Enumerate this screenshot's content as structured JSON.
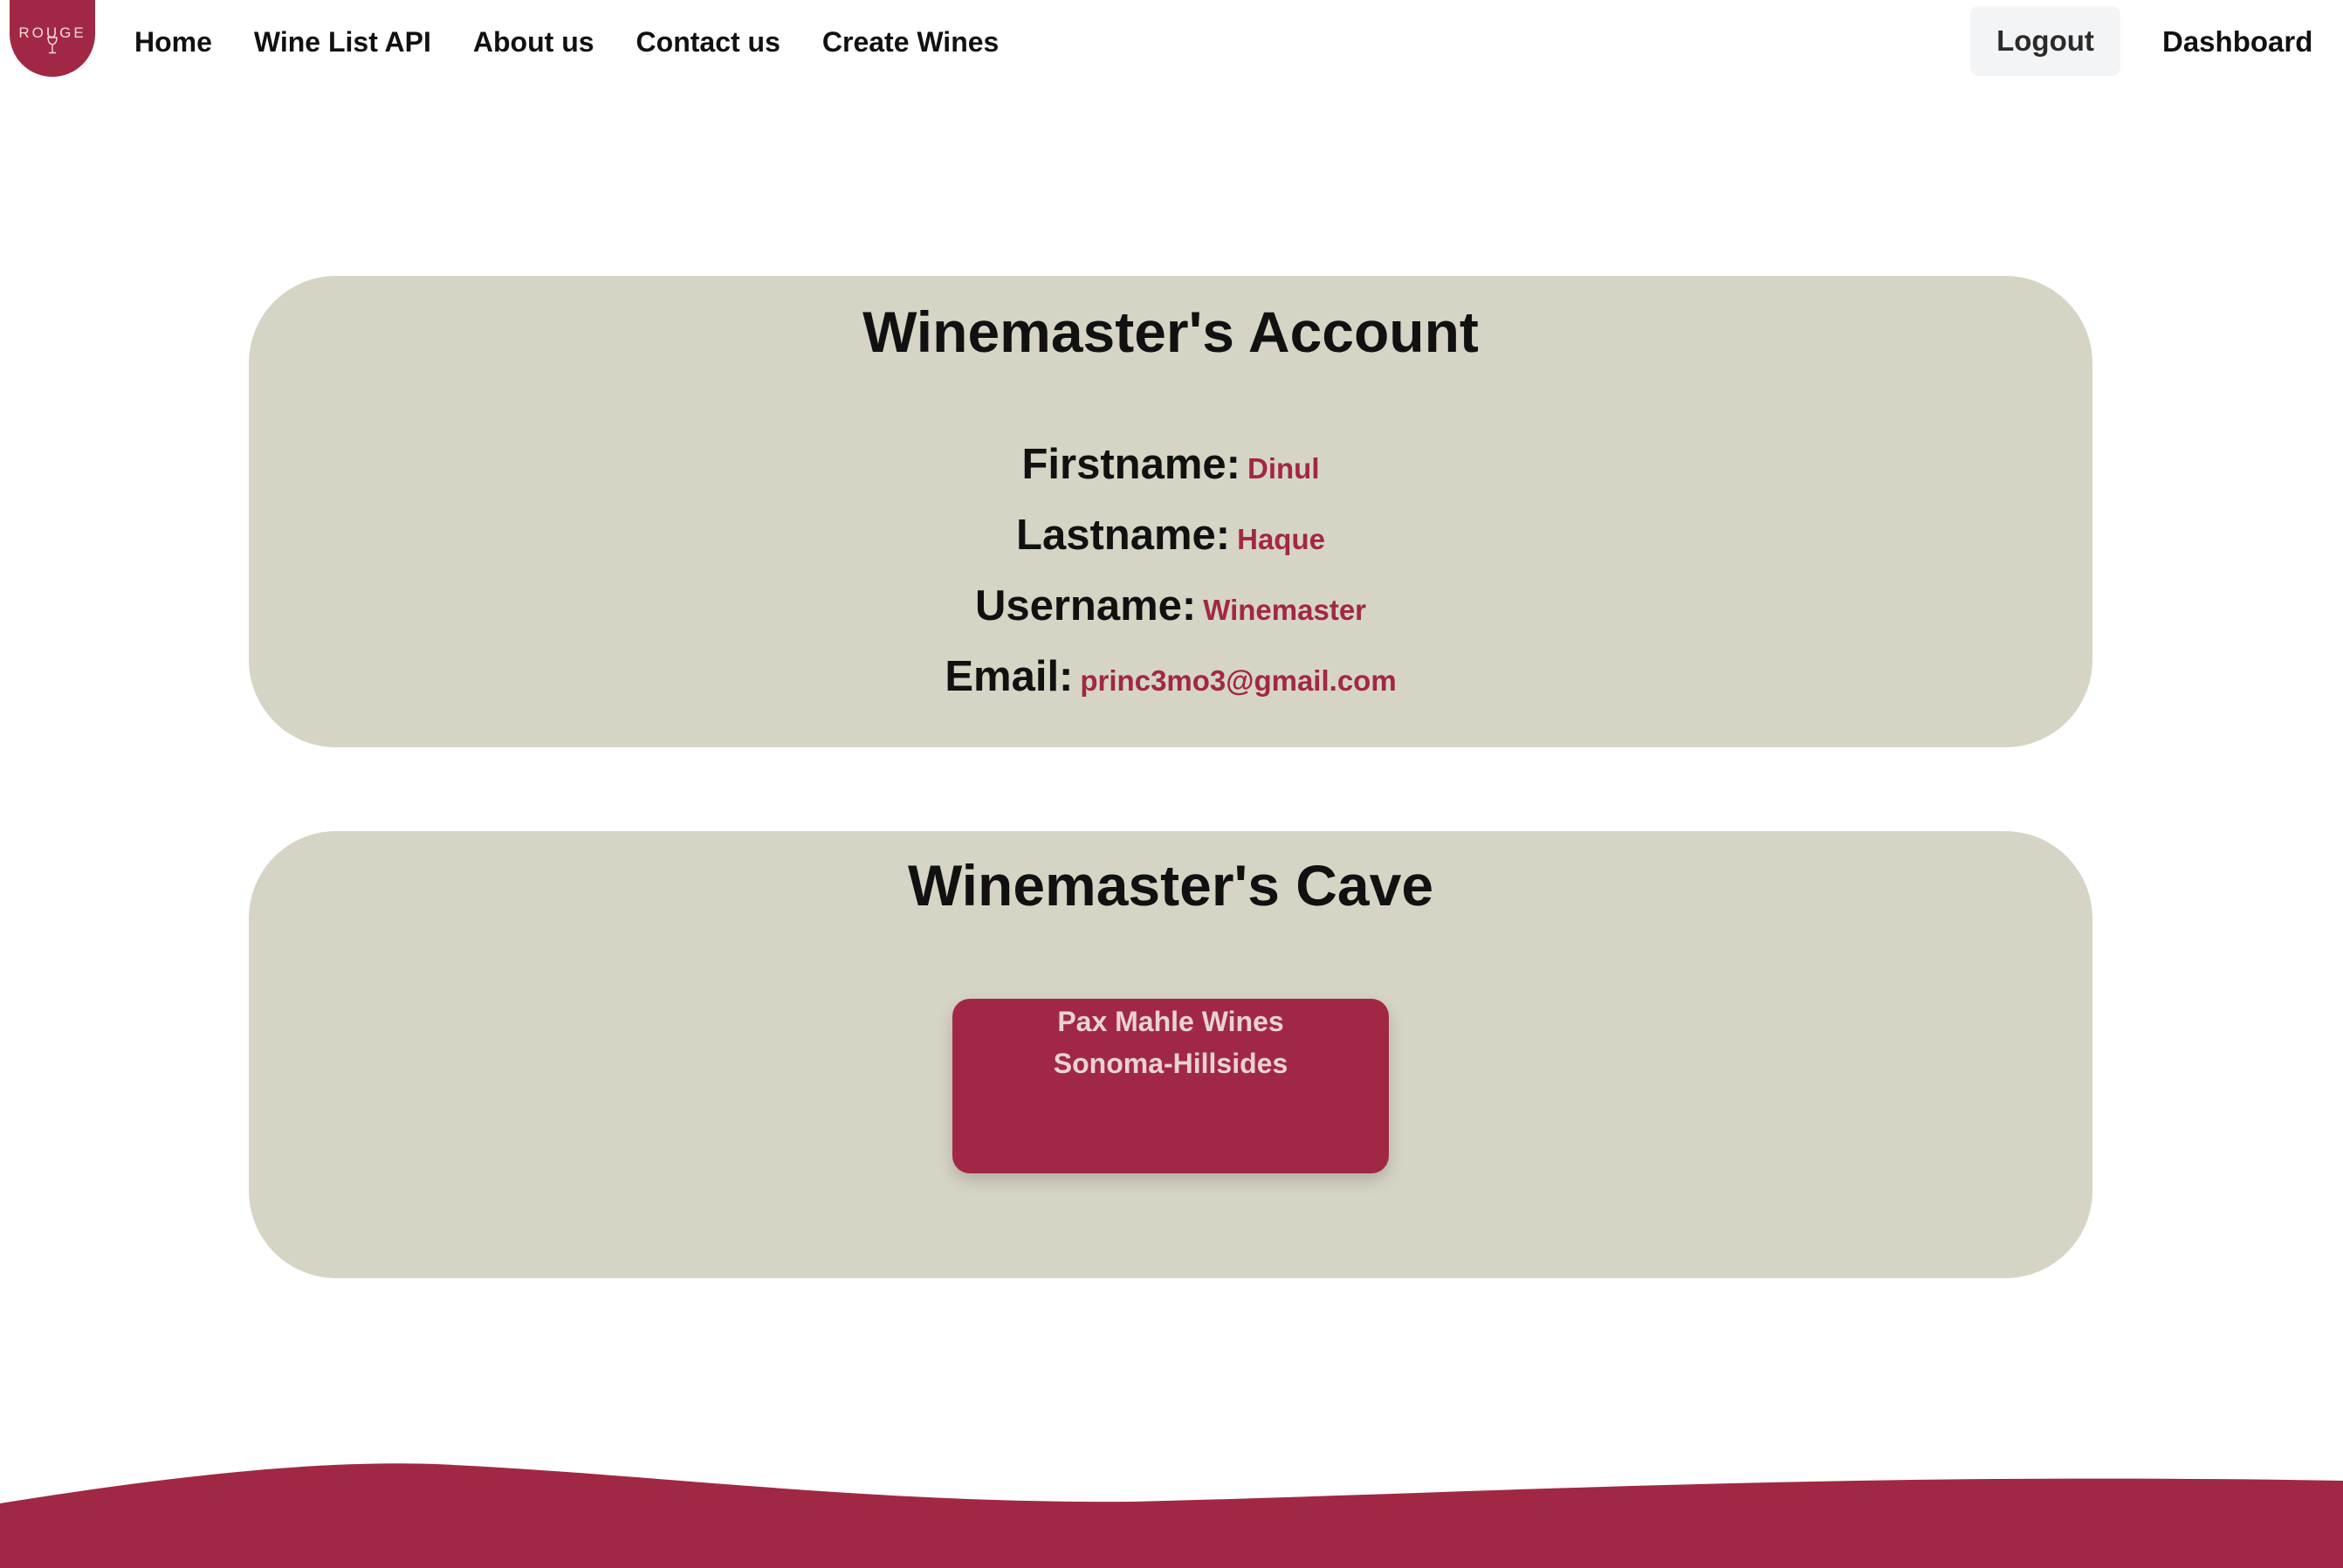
{
  "brand": {
    "logo_text": "ROUGE",
    "accent_color": "#a12844",
    "panel_color": "#d6d5c5"
  },
  "nav": {
    "links": [
      "Home",
      "Wine List API",
      "About us",
      "Contact us",
      "Create Wines"
    ],
    "logout_label": "Logout",
    "dashboard_label": "Dashboard"
  },
  "account": {
    "title": "Winemaster's Account",
    "fields": [
      {
        "label": "Firstname:",
        "value": "Dinul"
      },
      {
        "label": "Lastname:",
        "value": "Haque"
      },
      {
        "label": "Username:",
        "value": "Winemaster"
      },
      {
        "label": "Email:",
        "value": "princ3mo3@gmail.com"
      }
    ]
  },
  "cave": {
    "title": "Winemaster's Cave",
    "wines": [
      {
        "name": "Pax Mahle Wines",
        "region": "Sonoma-Hillsides"
      }
    ]
  }
}
